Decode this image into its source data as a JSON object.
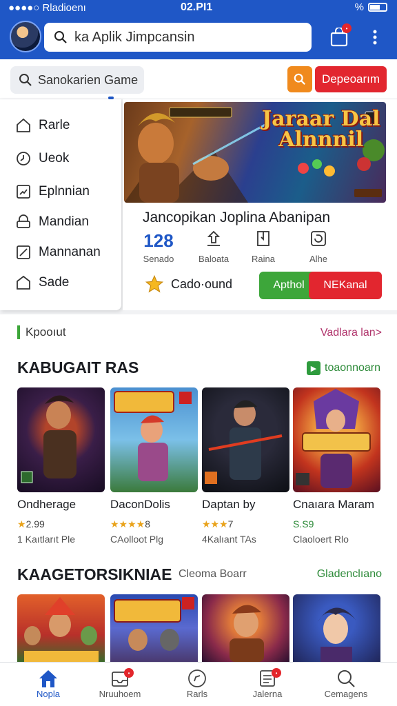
{
  "status_bar": {
    "carrier": "●●●●○ Rladioenı",
    "time": "02.PI1",
    "battery": "%"
  },
  "header": {
    "search_text": "ka Aplik  Jimpcansin"
  },
  "subbar": {
    "search_text": "Sanokarien Game",
    "action_label": "Depeoarım"
  },
  "menu": {
    "items": [
      {
        "label": "Rarle",
        "icon": "home-icon"
      },
      {
        "label": "Ueok",
        "icon": "clock-icon"
      },
      {
        "label": "Eplnnian",
        "icon": "chart-icon"
      },
      {
        "label": "Mandian",
        "icon": "user-icon"
      },
      {
        "label": "Mannanan",
        "icon": "edit-icon"
      },
      {
        "label": "Sade",
        "icon": "pentagon-icon"
      }
    ]
  },
  "featured": {
    "banner_title": "Jaraar Dal\nAlnnnil",
    "title": "Jancopikan Joplina Abanipan",
    "stats": [
      {
        "value": "128",
        "label": "Senado"
      },
      {
        "value": "",
        "label": "Baloata"
      },
      {
        "value": "",
        "label": "Raina"
      },
      {
        "value": "",
        "label": "Alhe"
      }
    ],
    "rating_text": "Cado·ound",
    "primary_button": "Apthol",
    "secondary_button": "NEKanal"
  },
  "section1": {
    "label": "Kpooıut",
    "link": "Vadlara lan>",
    "heading": "KABUGAIT RAS",
    "right_link": "toaonnoarn",
    "games": [
      {
        "name": "Ondherage",
        "stars": "★",
        "rating": "2.99",
        "sub": "1 Kaıtlarıt Ple"
      },
      {
        "name": "DaconDolis",
        "stars": "★★★★",
        "rating": "8",
        "sub": "CAolloot Plg"
      },
      {
        "name": "Daptan by",
        "stars": "★★★",
        "rating": "7",
        "sub": "4Kalıant TAs"
      },
      {
        "name": "Cnaıara Maram",
        "stars": "",
        "rating": "S.S9",
        "sub": "Claoloert Rlo"
      }
    ]
  },
  "section2": {
    "heading": "KAAGETORSIKNIAE",
    "mid_link": "Cleoma Boarr",
    "right_link": "Gladenclıano"
  },
  "bottom_nav": [
    {
      "label": "Nopla",
      "active": true
    },
    {
      "label": "Nruuhoem"
    },
    {
      "label": "Rarls"
    },
    {
      "label": "Jalerna"
    },
    {
      "label": "Cemagens"
    }
  ],
  "colors": {
    "primary": "#1f57c6",
    "accent_red": "#e2262f",
    "accent_green": "#3da63a",
    "accent_orange": "#f08a1d"
  }
}
